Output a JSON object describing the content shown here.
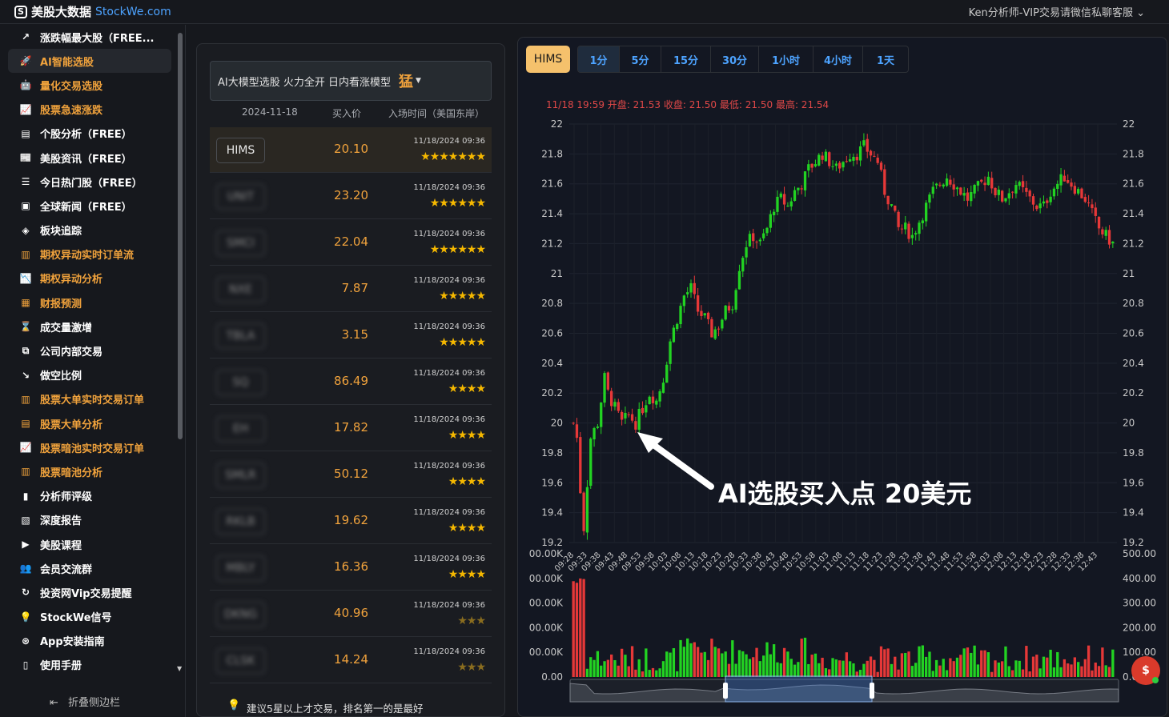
{
  "topbar": {
    "logo_mark": "S",
    "logo_text": "美股大数据",
    "logo_domain": "StockWe.com",
    "user_menu": "Ken分析师-VIP交易请微信私聊客服"
  },
  "sidebar": {
    "items": [
      {
        "label": "涨跌幅最大股（FREE...",
        "icon": "↗",
        "color": "white"
      },
      {
        "label": "AI智能选股",
        "icon": "🚀",
        "color": "orange",
        "active": true
      },
      {
        "label": "量化交易选股",
        "icon": "🤖",
        "color": "orange"
      },
      {
        "label": "股票急速涨跌",
        "icon": "📈",
        "color": "orange"
      },
      {
        "label": "个股分析（FREE）",
        "icon": "▤",
        "color": "white"
      },
      {
        "label": "美股资讯（FREE）",
        "icon": "📰",
        "color": "white"
      },
      {
        "label": "今日热门股（FREE）",
        "icon": "☰",
        "color": "white"
      },
      {
        "label": "全球新闻（FREE）",
        "icon": "▣",
        "color": "white"
      },
      {
        "label": "板块追踪",
        "icon": "◈",
        "color": "white"
      },
      {
        "label": "期权异动实时订单流",
        "icon": "▥",
        "color": "orange"
      },
      {
        "label": "期权异动分析",
        "icon": "📉",
        "color": "orange"
      },
      {
        "label": "财报预测",
        "icon": "▦",
        "color": "orange"
      },
      {
        "label": "成交量激增",
        "icon": "⌛",
        "color": "white"
      },
      {
        "label": "公司内部交易",
        "icon": "⧉",
        "color": "white"
      },
      {
        "label": "做空比例",
        "icon": "↘",
        "color": "white"
      },
      {
        "label": "股票大单实时交易订单",
        "icon": "▥",
        "color": "orange"
      },
      {
        "label": "股票大单分析",
        "icon": "▤",
        "color": "orange"
      },
      {
        "label": "股票暗池实时交易订单",
        "icon": "📈",
        "color": "orange"
      },
      {
        "label": "股票暗池分析",
        "icon": "▥",
        "color": "orange"
      },
      {
        "label": "分析师评级",
        "icon": "▮",
        "color": "white"
      },
      {
        "label": "深度报告",
        "icon": "▧",
        "color": "white"
      },
      {
        "label": "美股课程",
        "icon": "▶",
        "color": "white"
      },
      {
        "label": "会员交流群",
        "icon": "👥",
        "color": "white"
      },
      {
        "label": "投资网Vip交易提醒",
        "icon": "↻",
        "color": "white"
      },
      {
        "label": "StockWe信号",
        "icon": "💡",
        "color": "white"
      },
      {
        "label": "App安装指南",
        "icon": "⊛",
        "color": "white"
      },
      {
        "label": "使用手册",
        "icon": "▯",
        "color": "white"
      }
    ],
    "collapse_icon": "⇤",
    "collapse_label": "折叠侧边栏"
  },
  "picks": {
    "model_label": "AI大模型选股 火力全开 日内看涨模型",
    "model_flag": "猛",
    "header": {
      "date": "2024-11-18",
      "price": "买入价",
      "time": "入场时间（美国东岸）"
    },
    "rows": [
      {
        "symbol": "HIMS",
        "blur": false,
        "price": "20.10",
        "time": "11/18/2024 09:36",
        "stars": 7,
        "star_style": "gold"
      },
      {
        "symbol": "UNIT",
        "blur": true,
        "price": "23.20",
        "time": "11/18/2024 09:36",
        "stars": 6,
        "star_style": "gold"
      },
      {
        "symbol": "SMCI",
        "blur": true,
        "price": "22.04",
        "time": "11/18/2024 09:36",
        "stars": 6,
        "star_style": "gold"
      },
      {
        "symbol": "NXE",
        "blur": true,
        "price": "7.87",
        "time": "11/18/2024 09:36",
        "stars": 5,
        "star_style": "gold"
      },
      {
        "symbol": "TBLA",
        "blur": true,
        "price": "3.15",
        "time": "11/18/2024 09:36",
        "stars": 5,
        "star_style": "gold"
      },
      {
        "symbol": "SQ",
        "blur": true,
        "price": "86.49",
        "time": "11/18/2024 09:36",
        "stars": 4,
        "star_style": "gold"
      },
      {
        "symbol": "EH",
        "blur": true,
        "price": "17.82",
        "time": "11/18/2024 09:36",
        "stars": 4,
        "star_style": "gold"
      },
      {
        "symbol": "SMLR",
        "blur": true,
        "price": "50.12",
        "time": "11/18/2024 09:36",
        "stars": 4,
        "star_style": "gold"
      },
      {
        "symbol": "RKLB",
        "blur": true,
        "price": "19.62",
        "time": "11/18/2024 09:36",
        "stars": 4,
        "star_style": "gold"
      },
      {
        "symbol": "MBLY",
        "blur": true,
        "price": "16.36",
        "time": "11/18/2024 09:36",
        "stars": 4,
        "star_style": "gold"
      },
      {
        "symbol": "DKNG",
        "blur": true,
        "price": "40.96",
        "time": "11/18/2024 09:36",
        "stars": 3,
        "star_style": "dim"
      },
      {
        "symbol": "CLSK",
        "blur": true,
        "price": "14.24",
        "time": "11/18/2024 09:36",
        "stars": 3,
        "star_style": "dim"
      }
    ],
    "tip_icon": "💡",
    "tip": "建议5星以上才交易，排名第一的是最好"
  },
  "chart_panel": {
    "symbol": "HIMS",
    "timeframes": [
      "1分",
      "5分",
      "15分",
      "30分",
      "1小时",
      "4小时",
      "1天"
    ],
    "active_timeframe": "1分",
    "legend": {
      "time": "11/18 19:59",
      "open_label": "开盘",
      "open": "21.53",
      "close_label": "收盘",
      "close": "21.50",
      "low_label": "最低",
      "low": "21.50",
      "high_label": "最高",
      "high": "21.54"
    },
    "annotation": "AI选股买入点 20美元",
    "chat_icon": "$"
  },
  "chart_data": {
    "type": "candlestick",
    "x_ticks": [
      "09:28",
      "09:33",
      "09:38",
      "09:43",
      "09:48",
      "09:53",
      "09:58",
      "10:03",
      "10:08",
      "10:13",
      "10:18",
      "10:23",
      "10:28",
      "10:33",
      "10:38",
      "10:43",
      "10:48",
      "10:53",
      "10:58",
      "11:03",
      "11:08",
      "11:13",
      "11:18",
      "11:23",
      "11:28",
      "11:33",
      "11:38",
      "11:43",
      "11:48",
      "11:53",
      "11:58",
      "12:03",
      "12:08",
      "12:13",
      "12:18",
      "12:23",
      "12:28",
      "12:33",
      "12:38",
      "12:43"
    ],
    "ylim": [
      19.2,
      22.0
    ],
    "y_ticks": [
      "22",
      "21.8",
      "21.6",
      "21.4",
      "21.2",
      "21",
      "20.8",
      "20.6",
      "20.4",
      "20.2",
      "20",
      "19.8",
      "19.6",
      "19.4",
      "19.2"
    ],
    "volume_ticks_left": [
      "00.00K",
      "00.00K",
      "00.00K",
      "00.00K",
      "00.00K",
      "0.00"
    ],
    "volume_ticks_right": [
      "500.00",
      "400.00",
      "300.00",
      "200.00",
      "100.00",
      "0.00"
    ],
    "volume_max": 500,
    "close_path": [
      [
        0,
        20.0
      ],
      [
        1,
        19.9
      ],
      [
        2,
        19.55
      ],
      [
        3,
        19.3
      ],
      [
        4,
        19.6
      ],
      [
        5,
        19.9
      ],
      [
        7,
        20.0
      ],
      [
        9,
        20.3
      ],
      [
        10,
        20.2
      ],
      [
        12,
        20.1
      ],
      [
        14,
        20.0
      ],
      [
        16,
        20.05
      ],
      [
        18,
        20.0
      ],
      [
        20,
        20.1
      ],
      [
        22,
        20.2
      ],
      [
        24,
        20.15
      ],
      [
        26,
        20.3
      ],
      [
        28,
        20.55
      ],
      [
        30,
        20.7
      ],
      [
        32,
        20.85
      ],
      [
        34,
        20.9
      ],
      [
        36,
        20.75
      ],
      [
        38,
        20.7
      ],
      [
        40,
        20.6
      ],
      [
        42,
        20.65
      ],
      [
        44,
        20.75
      ],
      [
        46,
        20.8
      ],
      [
        48,
        21.05
      ],
      [
        50,
        21.2
      ],
      [
        52,
        21.25
      ],
      [
        54,
        21.2
      ],
      [
        56,
        21.3
      ],
      [
        58,
        21.45
      ],
      [
        60,
        21.5
      ],
      [
        62,
        21.45
      ],
      [
        64,
        21.55
      ],
      [
        66,
        21.6
      ],
      [
        68,
        21.7
      ],
      [
        70,
        21.75
      ],
      [
        72,
        21.8
      ],
      [
        74,
        21.75
      ],
      [
        76,
        21.7
      ],
      [
        78,
        21.75
      ],
      [
        80,
        21.8
      ],
      [
        82,
        21.8
      ],
      [
        84,
        21.85
      ],
      [
        86,
        21.8
      ],
      [
        88,
        21.75
      ],
      [
        90,
        21.55
      ],
      [
        92,
        21.45
      ],
      [
        94,
        21.3
      ],
      [
        96,
        21.3
      ],
      [
        98,
        21.25
      ],
      [
        100,
        21.35
      ],
      [
        102,
        21.45
      ],
      [
        104,
        21.55
      ],
      [
        106,
        21.6
      ],
      [
        108,
        21.65
      ],
      [
        110,
        21.6
      ],
      [
        112,
        21.55
      ],
      [
        114,
        21.5
      ],
      [
        116,
        21.55
      ],
      [
        118,
        21.6
      ],
      [
        120,
        21.65
      ],
      [
        122,
        21.55
      ],
      [
        124,
        21.5
      ],
      [
        126,
        21.55
      ],
      [
        128,
        21.6
      ],
      [
        130,
        21.55
      ],
      [
        132,
        21.5
      ],
      [
        134,
        21.45
      ],
      [
        136,
        21.45
      ],
      [
        138,
        21.55
      ],
      [
        140,
        21.6
      ],
      [
        142,
        21.65
      ],
      [
        144,
        21.6
      ],
      [
        146,
        21.55
      ],
      [
        148,
        21.5
      ],
      [
        150,
        21.4
      ],
      [
        152,
        21.3
      ],
      [
        154,
        21.25
      ],
      [
        156,
        21.2
      ]
    ],
    "candle_count": 157
  }
}
